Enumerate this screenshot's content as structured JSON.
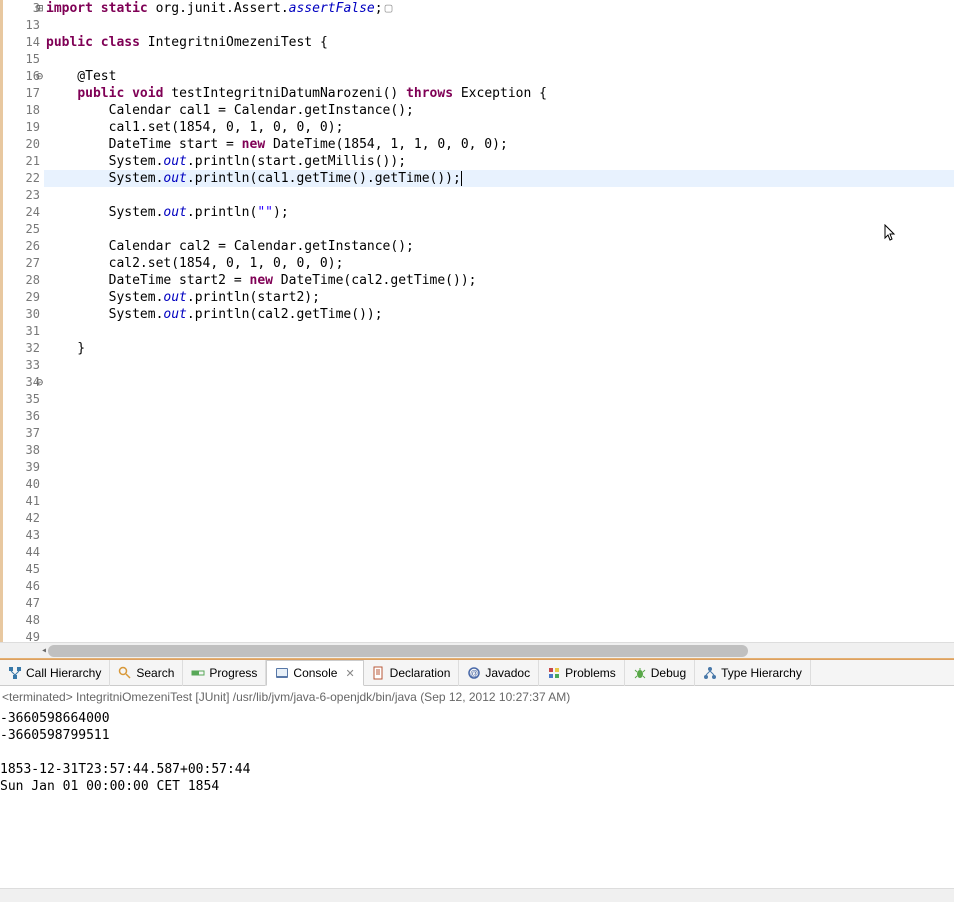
{
  "editor": {
    "lines": [
      {
        "n": "3",
        "fold": "plus",
        "tokens": [
          {
            "t": "kw",
            "v": "import"
          },
          {
            "t": "nm",
            "v": " "
          },
          {
            "t": "kw",
            "v": "static"
          },
          {
            "t": "nm",
            "v": " org.junit.Assert."
          },
          {
            "t": "it",
            "v": "assertFalse"
          },
          {
            "t": "nm",
            "v": ";"
          }
        ],
        "fold_box": true
      },
      {
        "n": "13",
        "tokens": []
      },
      {
        "n": "14",
        "tokens": [
          {
            "t": "kw",
            "v": "public"
          },
          {
            "t": "nm",
            "v": " "
          },
          {
            "t": "kw",
            "v": "class"
          },
          {
            "t": "nm",
            "v": " IntegritniOmezeniTest {"
          }
        ]
      },
      {
        "n": "15",
        "tokens": []
      },
      {
        "n": "16",
        "fold": "minus",
        "tokens": [
          {
            "t": "nm",
            "v": "    @Test"
          }
        ]
      },
      {
        "n": "17",
        "tokens": [
          {
            "t": "nm",
            "v": "    "
          },
          {
            "t": "kw",
            "v": "public"
          },
          {
            "t": "nm",
            "v": " "
          },
          {
            "t": "kw",
            "v": "void"
          },
          {
            "t": "nm",
            "v": " testIntegritniDatumNarozeni() "
          },
          {
            "t": "kw",
            "v": "throws"
          },
          {
            "t": "nm",
            "v": " Exception {"
          }
        ]
      },
      {
        "n": "18",
        "tokens": [
          {
            "t": "nm",
            "v": "        Calendar cal1 = Calendar.getInstance();"
          }
        ]
      },
      {
        "n": "19",
        "tokens": [
          {
            "t": "nm",
            "v": "        cal1.set(1854, 0, 1, 0, 0, 0);"
          }
        ]
      },
      {
        "n": "20",
        "tokens": [
          {
            "t": "nm",
            "v": "        DateTime start = "
          },
          {
            "t": "kw",
            "v": "new"
          },
          {
            "t": "nm",
            "v": " DateTime(1854, 1, 1, 0, 0, 0);"
          }
        ]
      },
      {
        "n": "21",
        "tokens": [
          {
            "t": "nm",
            "v": "        System."
          },
          {
            "t": "it",
            "v": "out"
          },
          {
            "t": "nm",
            "v": ".println(start.getMillis());"
          }
        ]
      },
      {
        "n": "22",
        "hl": true,
        "tokens": [
          {
            "t": "nm",
            "v": "        System."
          },
          {
            "t": "it",
            "v": "out"
          },
          {
            "t": "nm",
            "v": ".println(cal1.getTime().getTime());"
          }
        ],
        "caret": true
      },
      {
        "n": "23",
        "tokens": []
      },
      {
        "n": "24",
        "tokens": [
          {
            "t": "nm",
            "v": "        System."
          },
          {
            "t": "it",
            "v": "out"
          },
          {
            "t": "nm",
            "v": ".println("
          },
          {
            "t": "st",
            "v": "\"\""
          },
          {
            "t": "nm",
            "v": ");"
          }
        ]
      },
      {
        "n": "25",
        "tokens": []
      },
      {
        "n": "26",
        "tokens": [
          {
            "t": "nm",
            "v": "        Calendar cal2 = Calendar.getInstance();"
          }
        ]
      },
      {
        "n": "27",
        "tokens": [
          {
            "t": "nm",
            "v": "        cal2.set(1854, 0, 1, 0, 0, 0);"
          }
        ]
      },
      {
        "n": "28",
        "tokens": [
          {
            "t": "nm",
            "v": "        DateTime start2 = "
          },
          {
            "t": "kw",
            "v": "new"
          },
          {
            "t": "nm",
            "v": " DateTime(cal2.getTime());"
          }
        ]
      },
      {
        "n": "29",
        "tokens": [
          {
            "t": "nm",
            "v": "        System."
          },
          {
            "t": "it",
            "v": "out"
          },
          {
            "t": "nm",
            "v": ".println(start2);"
          }
        ]
      },
      {
        "n": "30",
        "tokens": [
          {
            "t": "nm",
            "v": "        System."
          },
          {
            "t": "it",
            "v": "out"
          },
          {
            "t": "nm",
            "v": ".println(cal2.getTime());"
          }
        ]
      },
      {
        "n": "31",
        "tokens": []
      },
      {
        "n": "32",
        "tokens": [
          {
            "t": "nm",
            "v": "    }"
          }
        ]
      },
      {
        "n": "33",
        "tokens": []
      },
      {
        "n": "34",
        "fold": "minus",
        "tokens": []
      },
      {
        "n": "35",
        "tokens": []
      },
      {
        "n": "36",
        "tokens": []
      },
      {
        "n": "37",
        "tokens": []
      },
      {
        "n": "38",
        "tokens": []
      },
      {
        "n": "39",
        "tokens": []
      },
      {
        "n": "40",
        "tokens": []
      },
      {
        "n": "41",
        "tokens": []
      },
      {
        "n": "42",
        "tokens": []
      },
      {
        "n": "43",
        "tokens": []
      },
      {
        "n": "44",
        "tokens": []
      },
      {
        "n": "45",
        "tokens": []
      },
      {
        "n": "46",
        "tokens": []
      },
      {
        "n": "47",
        "tokens": []
      },
      {
        "n": "48",
        "tokens": []
      },
      {
        "n": "49",
        "tokens": []
      }
    ]
  },
  "tabs": [
    {
      "icon": "call-hierarchy",
      "label": "Call Hierarchy",
      "active": false
    },
    {
      "icon": "search",
      "label": "Search",
      "active": false
    },
    {
      "icon": "progress",
      "label": "Progress",
      "active": false
    },
    {
      "icon": "console",
      "label": "Console",
      "active": true,
      "close": true
    },
    {
      "icon": "declaration",
      "label": "Declaration",
      "active": false
    },
    {
      "icon": "javadoc",
      "label": "Javadoc",
      "active": false
    },
    {
      "icon": "problems",
      "label": "Problems",
      "active": false
    },
    {
      "icon": "debug",
      "label": "Debug",
      "active": false
    },
    {
      "icon": "type-hierarchy",
      "label": "Type Hierarchy",
      "active": false
    }
  ],
  "console": {
    "header": "<terminated> IntegritniOmezeniTest [JUnit] /usr/lib/jvm/java-6-openjdk/bin/java (Sep 12, 2012 10:27:37 AM)",
    "lines": [
      "-3660598664000",
      "-3660598799511",
      "",
      "1853-12-31T23:57:44.587+00:57:44",
      "Sun Jan 01 00:00:00 CET 1854"
    ]
  },
  "icons": {
    "call-hierarchy": "#3878a8",
    "search": "#d89838",
    "progress": "#58a858",
    "console": "#5878a8",
    "declaration": "#b85838",
    "javadoc": "#4868a8",
    "problems": "#c84848",
    "debug": "#58a848",
    "type-hierarchy": "#4878a8"
  }
}
